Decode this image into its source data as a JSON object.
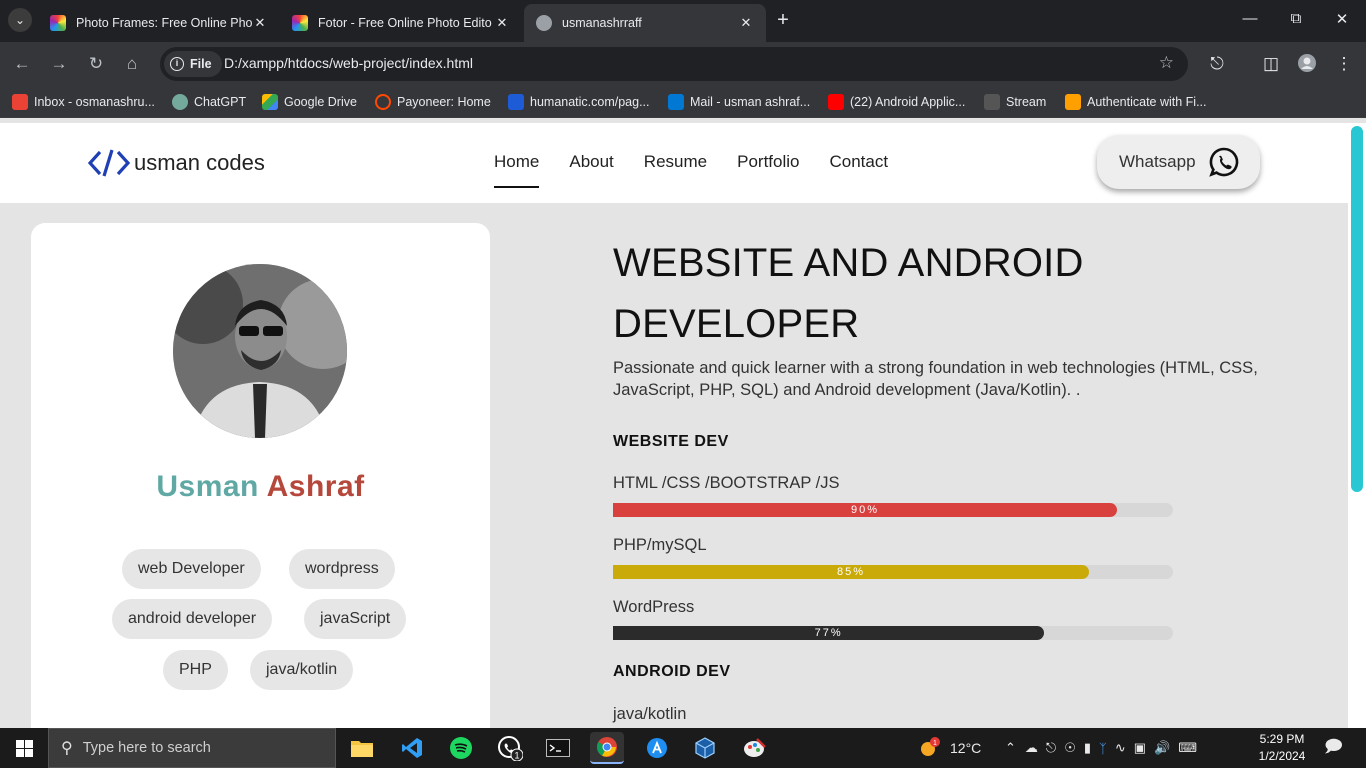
{
  "browser": {
    "tabs": [
      {
        "title": "Photo Frames: Free Online Phot",
        "active": false
      },
      {
        "title": "Fotor - Free Online Photo Edito",
        "active": false
      },
      {
        "title": "usmanashrraff",
        "active": true
      }
    ],
    "address": {
      "scheme_chip": "File",
      "url": "D:/xampp/htdocs/web-project/index.html"
    },
    "bookmarks": [
      {
        "label": "Inbox - osmanashru...",
        "icon": "gmail-icon",
        "color": "#ea4335"
      },
      {
        "label": "ChatGPT",
        "icon": "chatgpt-icon",
        "color": "#74aa9c"
      },
      {
        "label": "Google Drive",
        "icon": "drive-icon",
        "color": "#fbbc04"
      },
      {
        "label": "Payoneer: Home",
        "icon": "payoneer-icon",
        "color": "#ff4800"
      },
      {
        "label": "humanatic.com/pag...",
        "icon": "humanatic-icon",
        "color": "#1e5bd6"
      },
      {
        "label": "Mail - usman ashraf...",
        "icon": "outlook-icon",
        "color": "#0078d4"
      },
      {
        "label": "(22) Android Applic...",
        "icon": "youtube-icon",
        "color": "#ff0000"
      },
      {
        "label": "Stream",
        "icon": "stream-icon",
        "color": "#c8c8c8"
      },
      {
        "label": "Authenticate with Fi...",
        "icon": "firebase-icon",
        "color": "#ffa000"
      }
    ]
  },
  "site": {
    "logo_text": "usman codes",
    "nav": [
      "Home",
      "About",
      "Resume",
      "Portfolio",
      "Contact"
    ],
    "whatsapp_label": "Whatsapp",
    "profile": {
      "first_name": "Usman",
      "last_name": "Ashraf",
      "tags": [
        "web Developer",
        "wordpress",
        "android developer",
        "javaScript",
        "PHP",
        "java/kotlin"
      ]
    },
    "hero_title": "WEBSITE AND ANDROID DEVELOPER",
    "hero_desc": "Passionate and quick learner with a strong foundation in web technologies (HTML, CSS, JavaScript, PHP, SQL) and Android development (Java/Kotlin). .",
    "sections": [
      {
        "heading": "WEBSITE DEV",
        "skills": [
          {
            "label": "HTML /CSS /BOOTSTRAP /JS",
            "percent": 90,
            "percent_text": "90%",
            "color": "#d9413f"
          },
          {
            "label": "PHP/mySQL",
            "percent": 85,
            "percent_text": "85%",
            "color": "#c9aa08"
          },
          {
            "label": "WordPress",
            "percent": 77,
            "percent_text": "77%",
            "color": "#2b2b2b"
          }
        ]
      },
      {
        "heading": "ANDROID DEV",
        "skills": [
          {
            "label": "java/kotlin"
          }
        ]
      }
    ]
  },
  "taskbar": {
    "search_placeholder": "Type here to search",
    "weather": "12°C",
    "weather_badge": "1",
    "whatsapp_badge": "1",
    "time": "5:29 PM",
    "date": "1/2/2024"
  },
  "colors": {
    "accent_cyan": "#27c7d3",
    "name_first": "#5fa8a4",
    "name_last": "#b5473b"
  }
}
